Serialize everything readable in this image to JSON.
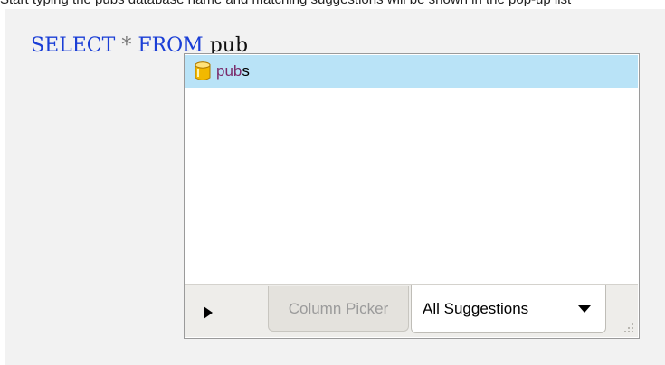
{
  "caption": {
    "text": "Start typing the pubs database name and matching suggestions will be shown in the pop-up list"
  },
  "editor": {
    "keyword_select": "SELECT",
    "operator_star": "*",
    "keyword_from": "FROM",
    "typed_text": "pub"
  },
  "suggestions": {
    "items": [
      {
        "matched": "pub",
        "rest": "s",
        "icon": "database-icon",
        "selected": true
      }
    ]
  },
  "footer": {
    "expand_icon": "play-icon",
    "tabs": [
      {
        "label": "Column Picker",
        "active": false
      },
      {
        "label": "All Suggestions",
        "active": true
      }
    ],
    "dropdown_icon": "chevron-down-icon",
    "resize_icon": "resize-grip-icon"
  },
  "colors": {
    "keyword": "#1a3ed6",
    "selection": "#b9e3f7",
    "match_highlight": "#7a2a6a",
    "database_icon": "#f2b900"
  }
}
